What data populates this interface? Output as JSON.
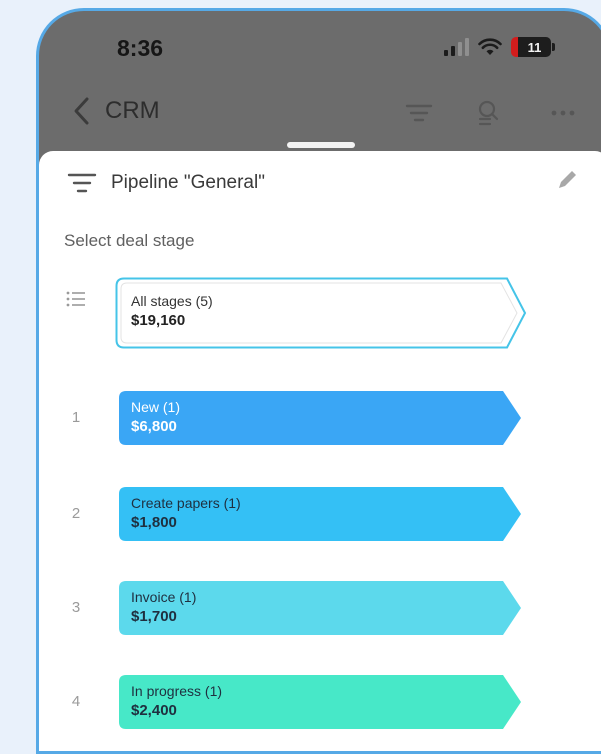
{
  "status_bar": {
    "time": "8:36",
    "battery": "11"
  },
  "nav": {
    "title": "CRM"
  },
  "pipeline": {
    "label": "Pipeline \"General\""
  },
  "section_label": "Select deal stage",
  "all_stages": {
    "name": "All stages (5)",
    "amount": "$19,160"
  },
  "stages": [
    {
      "index": "1",
      "name": "New (1)",
      "amount": "$6,800",
      "color": "#3aa6f5"
    },
    {
      "index": "2",
      "name": "Create papers (1)",
      "amount": "$1,800",
      "color": "#34c0f5"
    },
    {
      "index": "3",
      "name": "Invoice (1)",
      "amount": "$1,700",
      "color": "#5cd9ec"
    },
    {
      "index": "4",
      "name": "In progress (1)",
      "amount": "$2,400",
      "color": "#47e8c8"
    }
  ],
  "colors": {
    "outline": "#56a9e6",
    "header_bg": "#6c6c6c",
    "sheet_bg": "#ffffff",
    "selected_border": "#45c4e8"
  }
}
